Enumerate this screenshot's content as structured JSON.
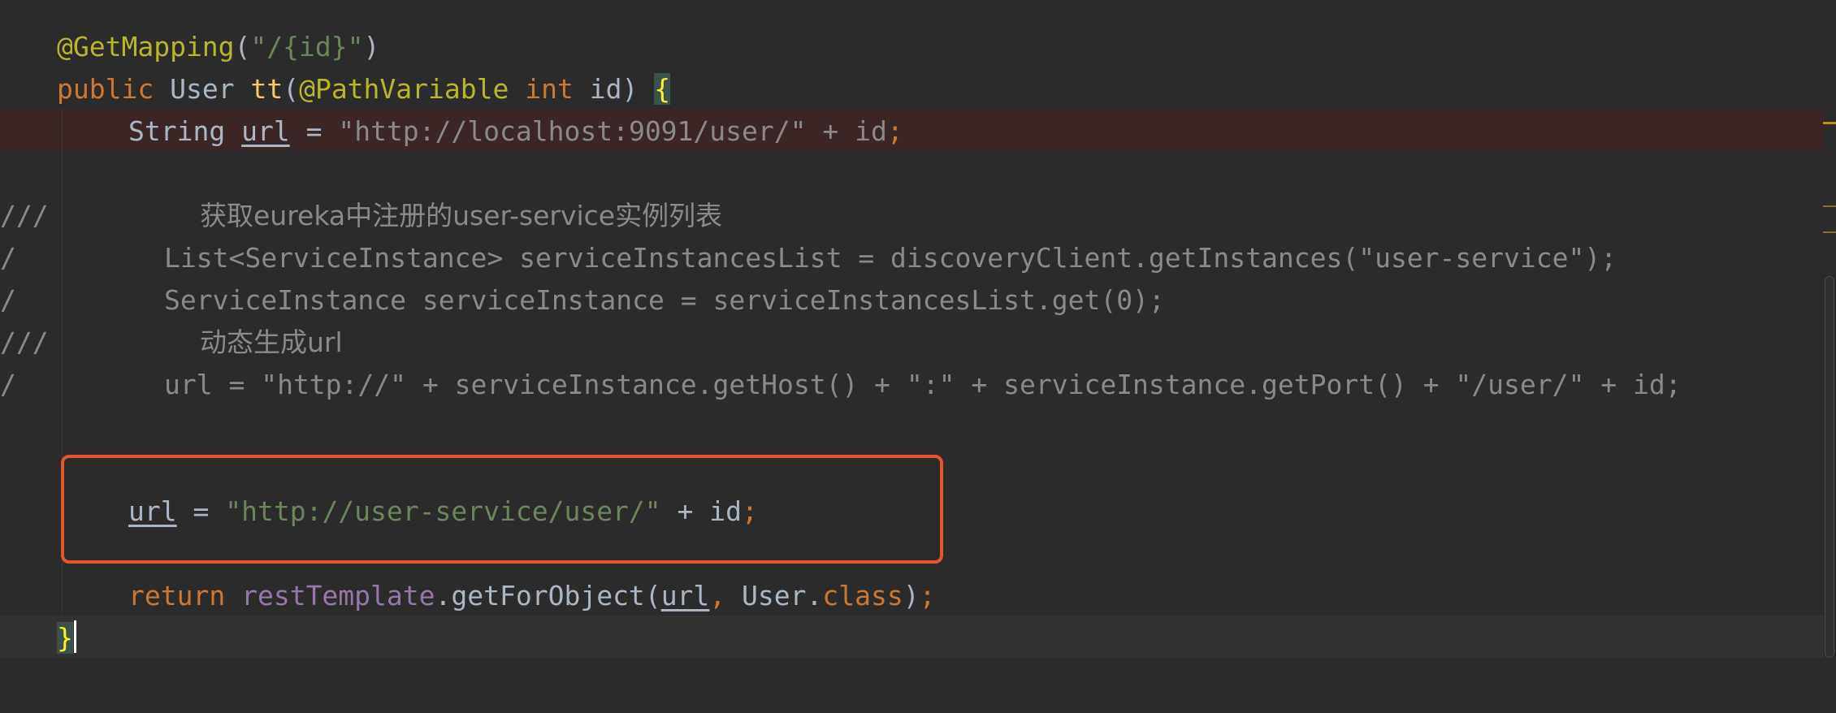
{
  "editor": {
    "line1": {
      "annotation": "@GetMapping",
      "paren_open": "(",
      "path_string": "\"/{id}\"",
      "paren_close": ")"
    },
    "line2": {
      "kw_public": "public",
      "type_user": "User",
      "method_name": "tt",
      "paren_open": "(",
      "annotation": "@PathVariable",
      "kw_int": "int",
      "param": "id",
      "paren_close": ")",
      "brace": "{"
    },
    "line3": {
      "type_string": "String",
      "var_url": "url",
      "op": "=",
      "url_string": "\"http://localhost:9091/user/\"",
      "concat": "+",
      "var_id": "id",
      "semicolon": ";"
    },
    "line5": {
      "prefix": "///",
      "comment": "获取eureka中注册的user-service实例列表"
    },
    "line6": {
      "prefix": "/",
      "code": "List<ServiceInstance> serviceInstancesList = discoveryClient.getInstances(\"user-service\");"
    },
    "line7": {
      "prefix": "/",
      "code": "ServiceInstance serviceInstance = serviceInstancesList.get(0);"
    },
    "line8": {
      "prefix": "///",
      "comment": "动态生成url"
    },
    "line9": {
      "prefix": "/",
      "code": "url = \"http://\" + serviceInstance.getHost() + \":\" + serviceInstance.getPort() + \"/user/\" + id;"
    },
    "line11": {
      "var_url": "url",
      "op": "=",
      "url_string": "\"http://user-service/user/\"",
      "concat": "+",
      "var_id": "id",
      "semicolon": ";"
    },
    "line12": {
      "kw_return": "return",
      "field": "restTemplate",
      "dot": ".",
      "method": "getForObject",
      "paren_open": "(",
      "var_url": "url",
      "comma": ",",
      "type_user": "User",
      "dot2": ".",
      "kw_class": "class",
      "paren_close": ")",
      "semicolon": ";"
    },
    "line13": {
      "brace": "}"
    }
  },
  "colors": {
    "background": "#2b2b2b",
    "keyword": "#cc7832",
    "annotation": "#bbb529",
    "string": "#6a8759",
    "field": "#9876aa",
    "method_decl": "#ffc66d",
    "highlight_box": "#e8542b",
    "error_line": "#3b2525"
  }
}
